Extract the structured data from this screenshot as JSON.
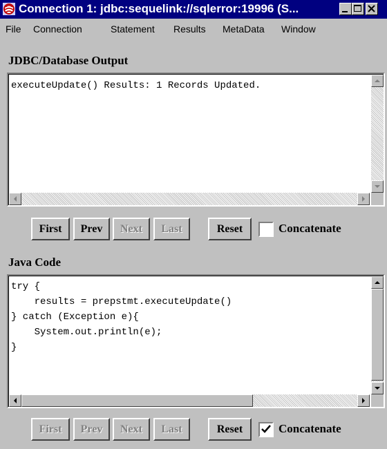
{
  "window": {
    "title": "Connection 1: jdbc:sequelink://sqlerror:19996 (S...",
    "controls": [
      "minimize-icon",
      "maximize-icon",
      "close-icon"
    ]
  },
  "menu": [
    "File",
    "Connection",
    "Statement",
    "Results",
    "MetaData",
    "Window"
  ],
  "output_section": {
    "title": "JDBC/Database Output",
    "text": "executeUpdate() Results: 1 Records Updated.",
    "buttons": [
      {
        "label": "First",
        "enabled": true
      },
      {
        "label": "Prev",
        "enabled": true
      },
      {
        "label": "Next",
        "enabled": false
      },
      {
        "label": "Last",
        "enabled": false
      },
      {
        "label": "Reset",
        "enabled": true
      }
    ],
    "concatenate": {
      "label": "Concatenate",
      "checked": false
    }
  },
  "code_section": {
    "title": "Java Code",
    "code": "try {\n    results = prepstmt.executeUpdate()\n} catch (Exception e){\n    System.out.println(e);\n}",
    "buttons": [
      {
        "label": "First",
        "enabled": false
      },
      {
        "label": "Prev",
        "enabled": false
      },
      {
        "label": "Next",
        "enabled": false
      },
      {
        "label": "Last",
        "enabled": false
      },
      {
        "label": "Reset",
        "enabled": true
      }
    ],
    "concatenate": {
      "label": "Concatenate",
      "checked": true
    }
  }
}
